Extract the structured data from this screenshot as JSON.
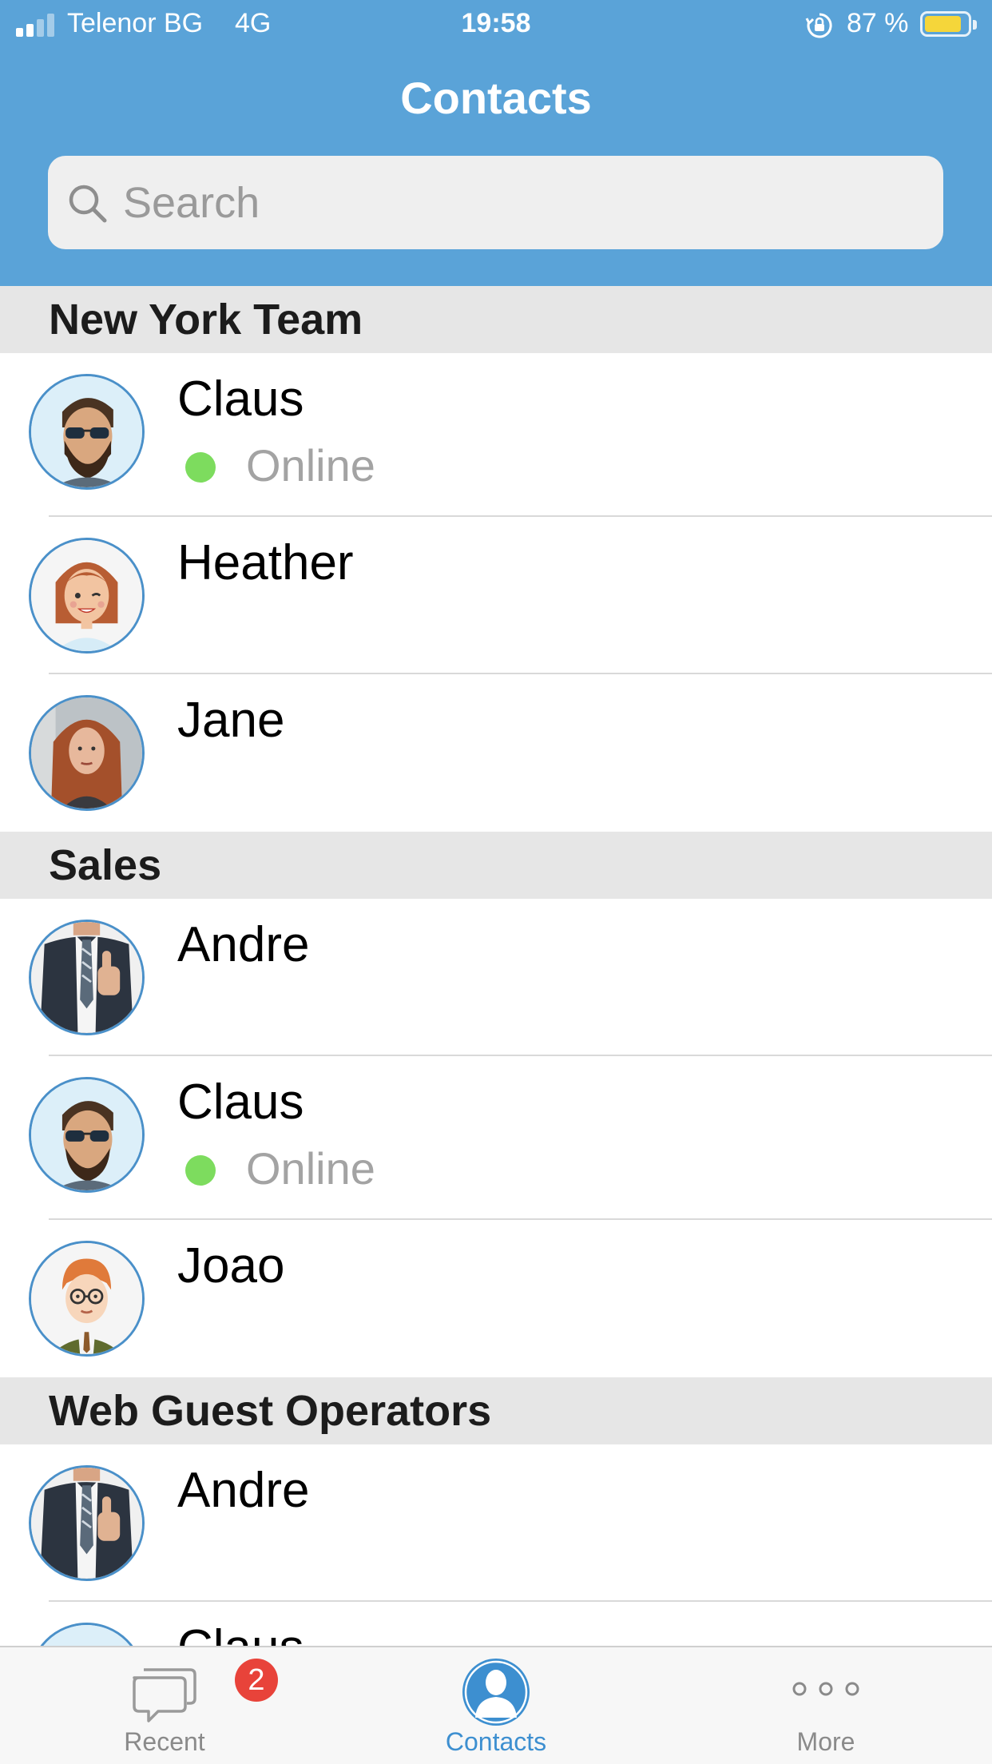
{
  "status_bar": {
    "carrier": "Telenor BG",
    "network": "4G",
    "time": "19:58",
    "battery": "87 %",
    "battery_level": 0.87
  },
  "header": {
    "title": "Contacts"
  },
  "search": {
    "placeholder": "Search",
    "value": ""
  },
  "sections": [
    {
      "name": "New York Team",
      "contacts": [
        {
          "name": "Claus",
          "status": "Online"
        },
        {
          "name": "Heather"
        },
        {
          "name": "Jane"
        }
      ]
    },
    {
      "name": "Sales",
      "contacts": [
        {
          "name": "Andre"
        },
        {
          "name": "Claus",
          "status": "Online"
        },
        {
          "name": "Joao"
        }
      ]
    },
    {
      "name": "Web Guest Operators",
      "contacts": [
        {
          "name": "Andre"
        },
        {
          "name": "Claus"
        }
      ]
    }
  ],
  "tab_bar": {
    "tabs": [
      {
        "label": "Recent",
        "badge": "2",
        "icon": "chat-bubbles-icon"
      },
      {
        "label": "Contacts",
        "icon": "person-icon",
        "active": true
      },
      {
        "label": "More",
        "icon": "more-dots-icon"
      }
    ]
  },
  "colors": {
    "header": "#5aa3d8",
    "accent": "#3d8fd0",
    "online": "#7ddc5e",
    "badge": "#e8433a",
    "battery": "#f5d63a"
  }
}
